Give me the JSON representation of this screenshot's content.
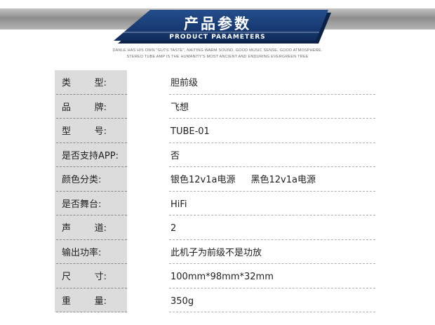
{
  "header": {
    "title": "产品参数",
    "subtitle": "PRODUCT PARAMETERS",
    "tagline_line1": "DANLE HAS HIS OWN \"GUTS TASTE\", NAITING WARM SOUND, GOOD MUSIC SENSE, GOOD ATMOSPHERE.",
    "tagline_line2": "STEREO TUBE AMP IS THE HUMANITY'S MOST ANCIENT AND ENDURING EVERGREEN TREE",
    "colors": {
      "banner_blue": "#1a3f7a",
      "banner_gray": "#8f8f8f"
    }
  },
  "specs": [
    {
      "label_a": "类",
      "label_b": "型:",
      "value": "胆前级"
    },
    {
      "label_a": "品",
      "label_b": "牌:",
      "value": "飞想"
    },
    {
      "label_a": "型",
      "label_b": "号:",
      "value": "TUBE-01"
    },
    {
      "label": "是否支持APP:",
      "value": "否"
    },
    {
      "label": "颜色分类:",
      "value": "银色12v1a电源",
      "value2": "黑色12v1a电源"
    },
    {
      "label": "是否舞台:",
      "value": "HiFi"
    },
    {
      "label_a": "声",
      "label_b": "道:",
      "value": "2"
    },
    {
      "label": "输出功率:",
      "value": "此机子为前级不是功放"
    },
    {
      "label_a": "尺",
      "label_b": "寸:",
      "value": "100mm*98mm*32mm"
    },
    {
      "label_a": "重",
      "label_b": "量:",
      "value": "350g"
    }
  ]
}
